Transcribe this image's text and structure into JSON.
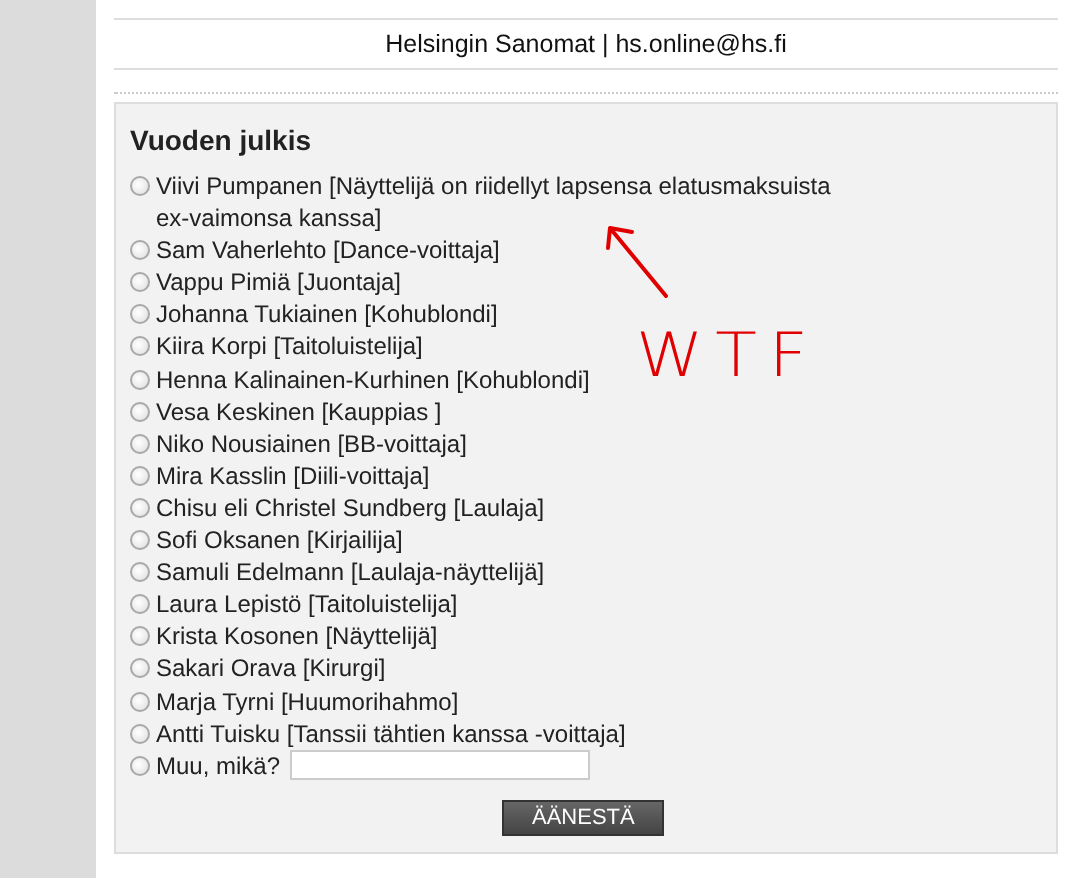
{
  "footer": {
    "text": "Helsingin Sanomat | hs.online@hs.fi"
  },
  "poll": {
    "title": "Vuoden julkis",
    "options": [
      {
        "label": "Viivi Pumpanen [Näyttelijä on riidellyt lapsensa elatusmaksuista ex-vaimonsa kanssa]",
        "selected": false
      },
      {
        "label": "Sam Vaherlehto [Dance-voittaja]",
        "selected": false
      },
      {
        "label": "Vappu Pimiä [Juontaja]",
        "selected": false
      },
      {
        "label": "Johanna Tukiainen [Kohublondi]",
        "selected": false
      },
      {
        "label": "Kiira Korpi [Taitoluistelija]",
        "selected": false
      },
      {
        "label": "Henna Kalinainen-Kurhinen [Kohublondi]",
        "selected": false
      },
      {
        "label": "Vesa Keskinen [Kauppias ]",
        "selected": false
      },
      {
        "label": "Niko Nousiainen [BB-voittaja]",
        "selected": false
      },
      {
        "label": "Mira Kasslin [Diili-voittaja]",
        "selected": false
      },
      {
        "label": "Chisu eli Christel Sundberg [Laulaja]",
        "selected": false
      },
      {
        "label": "Sofi Oksanen [Kirjailija]",
        "selected": false
      },
      {
        "label": "Samuli Edelmann [Laulaja-näyttelijä]",
        "selected": false
      },
      {
        "label": "Laura Lepistö [Taitoluistelija]",
        "selected": false
      },
      {
        "label": "Krista Kosonen [Näyttelijä]",
        "selected": false
      },
      {
        "label": "Sakari Orava [Kirurgi]",
        "selected": false
      },
      {
        "label": "Marja Tyrni [Huumorihahmo]",
        "selected": false
      },
      {
        "label": "Antti Tuisku [Tanssii tähtien kanssa -voittaja]",
        "selected": false
      },
      {
        "label": "Muu, mikä?",
        "selected": false,
        "kind": "other"
      }
    ],
    "button": "ÄÄNESTÄ"
  },
  "annotation": {
    "text": "WTF"
  }
}
